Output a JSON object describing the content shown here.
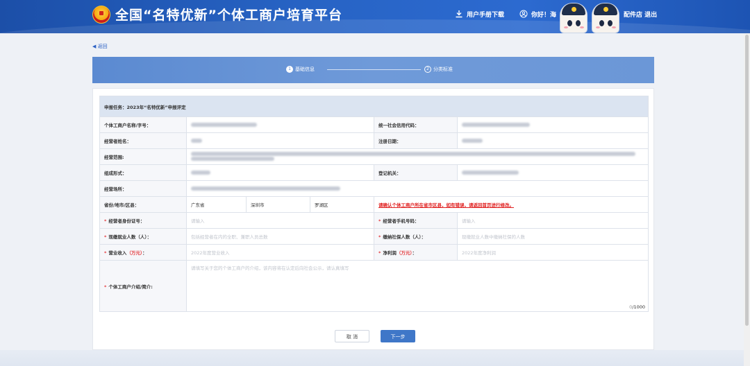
{
  "header": {
    "title": "全国“名特优新”个体工商户培育平台",
    "manual_label": "用户手册下载",
    "greeting": "你好！海",
    "store_exit": "配件店 退出",
    "icons": [
      "emblem-icon",
      "download-icon",
      "user-icon"
    ]
  },
  "nav": {
    "back_label": "返回"
  },
  "steps": [
    {
      "num": "1",
      "label": "基础信息",
      "active": true
    },
    {
      "num": "2",
      "label": "分类标准",
      "active": false
    }
  ],
  "form": {
    "section_title": "申报任务：2023年“名特优新”申报评定",
    "labels": {
      "name_or_brand": "个体工商户名称/字号：",
      "credit_code": "统一社会信用代码：",
      "operator_name": "经营者姓名：",
      "reg_date": "注册日期：",
      "scope": "经营范围:",
      "form": "组成形式：",
      "reg_authority": "登记机关：",
      "place": "经营场所：",
      "region": "省份/地市/区县：",
      "id_no": "经营者身份证号：",
      "phone": "经营者手机号码：",
      "employees_prefix": "现缴就业人数",
      "employees_unit": "（人）",
      "insured_prefix": "缴纳社保人数",
      "insured_unit": "（人）",
      "revenue_prefix": "营业收入",
      "revenue_unit": "（万元）",
      "profit_prefix": "净利润",
      "profit_unit": "（万元）",
      "intro": "个体工商户介绍/简介:"
    },
    "values": {
      "province": "广东省",
      "city": "深圳市",
      "district": "罗湖区",
      "region_warning": "请确认个体工商户所在省市区县，如有错误，请返回首页进行修改。"
    },
    "placeholders": {
      "id_no": "请输入",
      "phone": "请输入",
      "employees": "包括经营者在内的全职、兼职人员总数",
      "insured": "现缴就业人数中缴纳社保的人数",
      "revenue": "2022年度营业收入",
      "profit": "2022年度净利润",
      "intro": "请填写关于您的个体工商户的介绍，该内容将在认定后向社会公示，请认真填写"
    },
    "intro_counter": {
      "current": "0",
      "max": "/1000"
    }
  },
  "buttons": {
    "cancel": "取 消",
    "next": "下一步"
  },
  "colors": {
    "header": "#2763c4",
    "steps_bar": "#6f9ad9",
    "accent": "#3f77c8",
    "required": "#e4393c",
    "warning": "#e02020"
  }
}
